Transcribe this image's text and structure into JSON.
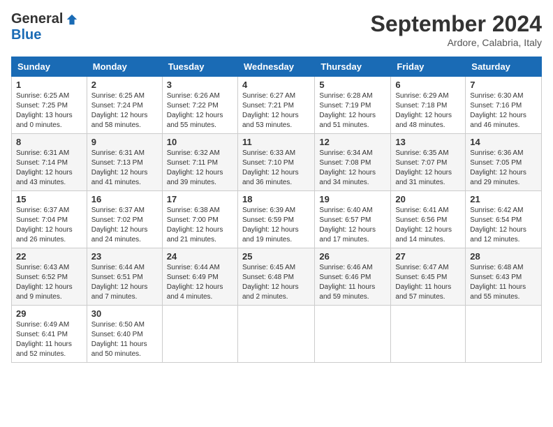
{
  "logo": {
    "general": "General",
    "blue": "Blue"
  },
  "title": "September 2024",
  "subtitle": "Ardore, Calabria, Italy",
  "headers": [
    "Sunday",
    "Monday",
    "Tuesday",
    "Wednesday",
    "Thursday",
    "Friday",
    "Saturday"
  ],
  "weeks": [
    [
      {
        "day": "1",
        "sunrise": "Sunrise: 6:25 AM",
        "sunset": "Sunset: 7:25 PM",
        "daylight": "Daylight: 13 hours and 0 minutes."
      },
      {
        "day": "2",
        "sunrise": "Sunrise: 6:25 AM",
        "sunset": "Sunset: 7:24 PM",
        "daylight": "Daylight: 12 hours and 58 minutes."
      },
      {
        "day": "3",
        "sunrise": "Sunrise: 6:26 AM",
        "sunset": "Sunset: 7:22 PM",
        "daylight": "Daylight: 12 hours and 55 minutes."
      },
      {
        "day": "4",
        "sunrise": "Sunrise: 6:27 AM",
        "sunset": "Sunset: 7:21 PM",
        "daylight": "Daylight: 12 hours and 53 minutes."
      },
      {
        "day": "5",
        "sunrise": "Sunrise: 6:28 AM",
        "sunset": "Sunset: 7:19 PM",
        "daylight": "Daylight: 12 hours and 51 minutes."
      },
      {
        "day": "6",
        "sunrise": "Sunrise: 6:29 AM",
        "sunset": "Sunset: 7:18 PM",
        "daylight": "Daylight: 12 hours and 48 minutes."
      },
      {
        "day": "7",
        "sunrise": "Sunrise: 6:30 AM",
        "sunset": "Sunset: 7:16 PM",
        "daylight": "Daylight: 12 hours and 46 minutes."
      }
    ],
    [
      {
        "day": "8",
        "sunrise": "Sunrise: 6:31 AM",
        "sunset": "Sunset: 7:14 PM",
        "daylight": "Daylight: 12 hours and 43 minutes."
      },
      {
        "day": "9",
        "sunrise": "Sunrise: 6:31 AM",
        "sunset": "Sunset: 7:13 PM",
        "daylight": "Daylight: 12 hours and 41 minutes."
      },
      {
        "day": "10",
        "sunrise": "Sunrise: 6:32 AM",
        "sunset": "Sunset: 7:11 PM",
        "daylight": "Daylight: 12 hours and 39 minutes."
      },
      {
        "day": "11",
        "sunrise": "Sunrise: 6:33 AM",
        "sunset": "Sunset: 7:10 PM",
        "daylight": "Daylight: 12 hours and 36 minutes."
      },
      {
        "day": "12",
        "sunrise": "Sunrise: 6:34 AM",
        "sunset": "Sunset: 7:08 PM",
        "daylight": "Daylight: 12 hours and 34 minutes."
      },
      {
        "day": "13",
        "sunrise": "Sunrise: 6:35 AM",
        "sunset": "Sunset: 7:07 PM",
        "daylight": "Daylight: 12 hours and 31 minutes."
      },
      {
        "day": "14",
        "sunrise": "Sunrise: 6:36 AM",
        "sunset": "Sunset: 7:05 PM",
        "daylight": "Daylight: 12 hours and 29 minutes."
      }
    ],
    [
      {
        "day": "15",
        "sunrise": "Sunrise: 6:37 AM",
        "sunset": "Sunset: 7:04 PM",
        "daylight": "Daylight: 12 hours and 26 minutes."
      },
      {
        "day": "16",
        "sunrise": "Sunrise: 6:37 AM",
        "sunset": "Sunset: 7:02 PM",
        "daylight": "Daylight: 12 hours and 24 minutes."
      },
      {
        "day": "17",
        "sunrise": "Sunrise: 6:38 AM",
        "sunset": "Sunset: 7:00 PM",
        "daylight": "Daylight: 12 hours and 21 minutes."
      },
      {
        "day": "18",
        "sunrise": "Sunrise: 6:39 AM",
        "sunset": "Sunset: 6:59 PM",
        "daylight": "Daylight: 12 hours and 19 minutes."
      },
      {
        "day": "19",
        "sunrise": "Sunrise: 6:40 AM",
        "sunset": "Sunset: 6:57 PM",
        "daylight": "Daylight: 12 hours and 17 minutes."
      },
      {
        "day": "20",
        "sunrise": "Sunrise: 6:41 AM",
        "sunset": "Sunset: 6:56 PM",
        "daylight": "Daylight: 12 hours and 14 minutes."
      },
      {
        "day": "21",
        "sunrise": "Sunrise: 6:42 AM",
        "sunset": "Sunset: 6:54 PM",
        "daylight": "Daylight: 12 hours and 12 minutes."
      }
    ],
    [
      {
        "day": "22",
        "sunrise": "Sunrise: 6:43 AM",
        "sunset": "Sunset: 6:52 PM",
        "daylight": "Daylight: 12 hours and 9 minutes."
      },
      {
        "day": "23",
        "sunrise": "Sunrise: 6:44 AM",
        "sunset": "Sunset: 6:51 PM",
        "daylight": "Daylight: 12 hours and 7 minutes."
      },
      {
        "day": "24",
        "sunrise": "Sunrise: 6:44 AM",
        "sunset": "Sunset: 6:49 PM",
        "daylight": "Daylight: 12 hours and 4 minutes."
      },
      {
        "day": "25",
        "sunrise": "Sunrise: 6:45 AM",
        "sunset": "Sunset: 6:48 PM",
        "daylight": "Daylight: 12 hours and 2 minutes."
      },
      {
        "day": "26",
        "sunrise": "Sunrise: 6:46 AM",
        "sunset": "Sunset: 6:46 PM",
        "daylight": "Daylight: 11 hours and 59 minutes."
      },
      {
        "day": "27",
        "sunrise": "Sunrise: 6:47 AM",
        "sunset": "Sunset: 6:45 PM",
        "daylight": "Daylight: 11 hours and 57 minutes."
      },
      {
        "day": "28",
        "sunrise": "Sunrise: 6:48 AM",
        "sunset": "Sunset: 6:43 PM",
        "daylight": "Daylight: 11 hours and 55 minutes."
      }
    ],
    [
      {
        "day": "29",
        "sunrise": "Sunrise: 6:49 AM",
        "sunset": "Sunset: 6:41 PM",
        "daylight": "Daylight: 11 hours and 52 minutes."
      },
      {
        "day": "30",
        "sunrise": "Sunrise: 6:50 AM",
        "sunset": "Sunset: 6:40 PM",
        "daylight": "Daylight: 11 hours and 50 minutes."
      },
      null,
      null,
      null,
      null,
      null
    ]
  ]
}
